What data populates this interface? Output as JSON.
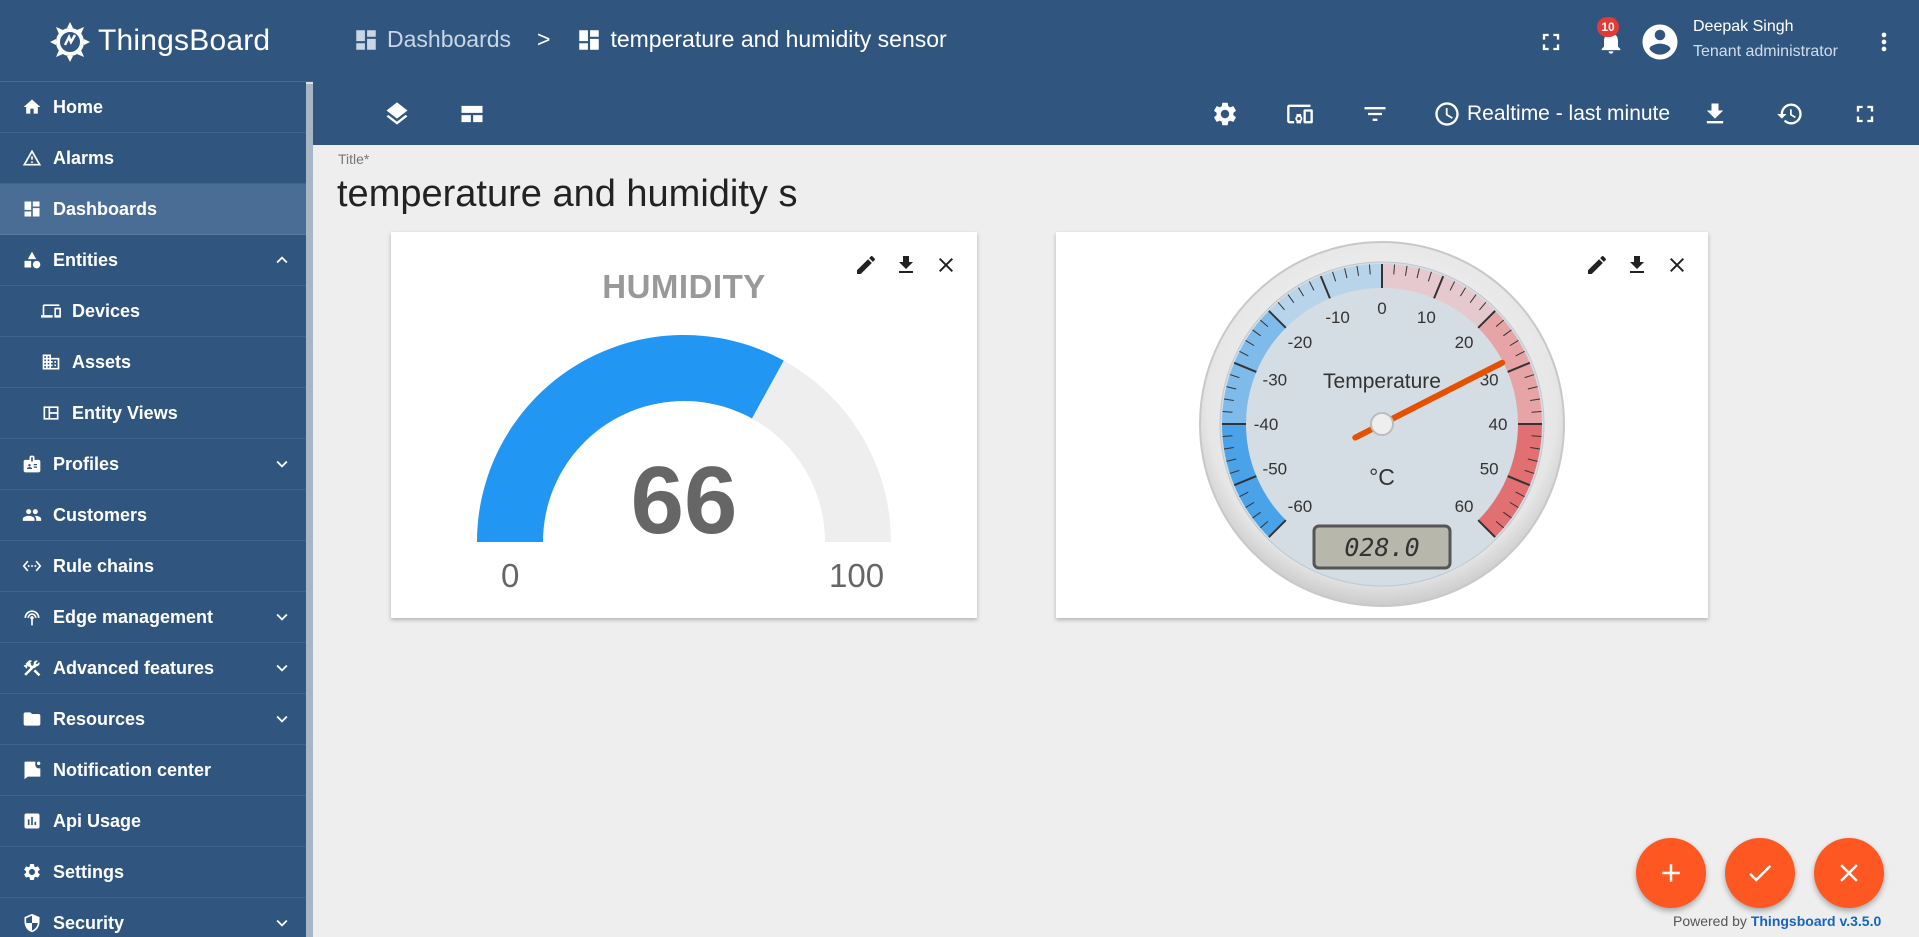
{
  "app": {
    "name": "ThingsBoard"
  },
  "sidebar": {
    "items": [
      {
        "label": "Home"
      },
      {
        "label": "Alarms"
      },
      {
        "label": "Dashboards"
      },
      {
        "label": "Entities"
      },
      {
        "label": "Devices"
      },
      {
        "label": "Assets"
      },
      {
        "label": "Entity Views"
      },
      {
        "label": "Profiles"
      },
      {
        "label": "Customers"
      },
      {
        "label": "Rule chains"
      },
      {
        "label": "Edge management"
      },
      {
        "label": "Advanced features"
      },
      {
        "label": "Resources"
      },
      {
        "label": "Notification center"
      },
      {
        "label": "Api Usage"
      },
      {
        "label": "Settings"
      },
      {
        "label": "Security"
      }
    ],
    "active": "Dashboards"
  },
  "header": {
    "breadcrumb": [
      "Dashboards",
      "temperature and humidity sensor"
    ],
    "separator": ">",
    "notification_count": "10",
    "user_name": "Deepak Singh",
    "user_role": "Tenant administrator"
  },
  "toolbar": {
    "timewindow_label": "Realtime - last minute"
  },
  "dashboard": {
    "title_label": "Title*",
    "title_value": "temperature and humidity sensor"
  },
  "widgets": {
    "humidity": {
      "title": "HUMIDITY",
      "value": "66",
      "min": "0",
      "max": "100",
      "fill_fraction": 0.66,
      "color": "#2196f3",
      "track_color": "#eeeeee"
    },
    "temperature": {
      "title": "Temperature",
      "unit": "°C",
      "value": 28.0,
      "display": "028.0",
      "min": -60,
      "max": 60,
      "tick_labels": [
        "-60",
        "-50",
        "-40",
        "-30",
        "-20",
        "-10",
        "0",
        "10",
        "20",
        "30",
        "40",
        "50",
        "60"
      ],
      "needle_color": "#e65100"
    }
  },
  "footer": {
    "powered_by": "Powered by",
    "powered_link": "Thingsboard v.3.5.0"
  },
  "colors": {
    "primary": "#305680",
    "accent": "#ff5722",
    "active_nav": "#4a6d96"
  }
}
